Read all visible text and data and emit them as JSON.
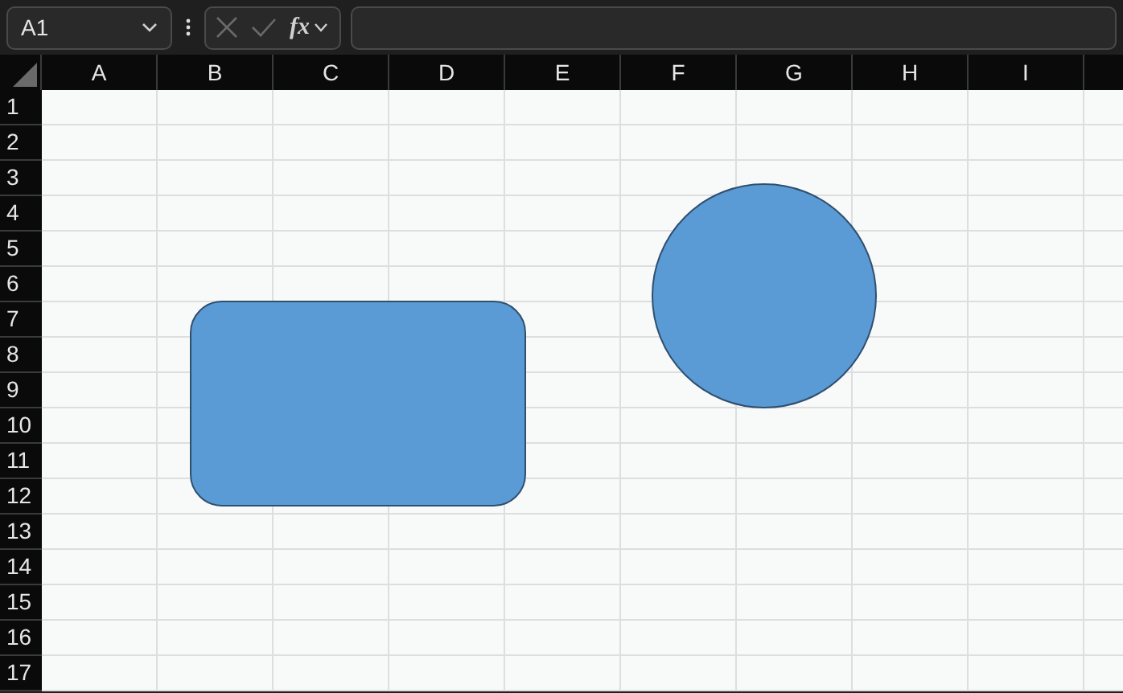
{
  "name_box": {
    "value": "A1"
  },
  "formula_bar": {
    "function_label": "fx"
  },
  "columns": [
    "A",
    "B",
    "C",
    "D",
    "E",
    "F",
    "G",
    "H",
    "I"
  ],
  "rows": [
    "1",
    "2",
    "3",
    "4",
    "5",
    "6",
    "7",
    "8",
    "9",
    "10",
    "11",
    "12",
    "13",
    "14",
    "15",
    "16",
    "17"
  ],
  "shapes": [
    {
      "kind": "rounded-rectangle"
    },
    {
      "kind": "ellipse"
    }
  ]
}
